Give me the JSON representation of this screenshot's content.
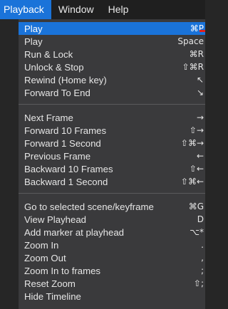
{
  "menubar": {
    "items": [
      "Playback",
      "Window",
      "Help"
    ]
  },
  "menu": {
    "items": [
      {
        "label": "Play",
        "shortcut": "⌘P"
      },
      {
        "label": "Play",
        "shortcut": "Space"
      },
      {
        "label": "Run & Lock",
        "shortcut": "⌘R"
      },
      {
        "label": "Unlock & Stop",
        "shortcut": "⇧⌘R"
      },
      {
        "label": "Rewind (Home key)",
        "shortcut": "↖"
      },
      {
        "label": "Forward To End",
        "shortcut": "↘"
      },
      {
        "label": "Next Frame",
        "shortcut": "→"
      },
      {
        "label": "Forward 10 Frames",
        "shortcut": "⇧→"
      },
      {
        "label": "Forward 1 Second",
        "shortcut": "⇧⌘→"
      },
      {
        "label": "Previous Frame",
        "shortcut": "←"
      },
      {
        "label": "Backward 10 Frames",
        "shortcut": "⇧←"
      },
      {
        "label": "Backward 1 Second",
        "shortcut": "⇧⌘←"
      },
      {
        "label": "Go to selected scene/keyframe",
        "shortcut": "⌘G"
      },
      {
        "label": "View Playhead",
        "shortcut": "D"
      },
      {
        "label": "Add marker at playhead",
        "shortcut": "⌥*"
      },
      {
        "label": "Zoom In",
        "shortcut": "."
      },
      {
        "label": "Zoom Out",
        "shortcut": ","
      },
      {
        "label": "Zoom In to frames",
        "shortcut": ";"
      },
      {
        "label": "Reset Zoom",
        "shortcut": "⇧;"
      },
      {
        "label": "Hide Timeline",
        "shortcut": ""
      }
    ]
  },
  "colors": {
    "highlight": "#1a73d9",
    "menu_background": "#3a3a3c",
    "indicator": "#e02020"
  }
}
